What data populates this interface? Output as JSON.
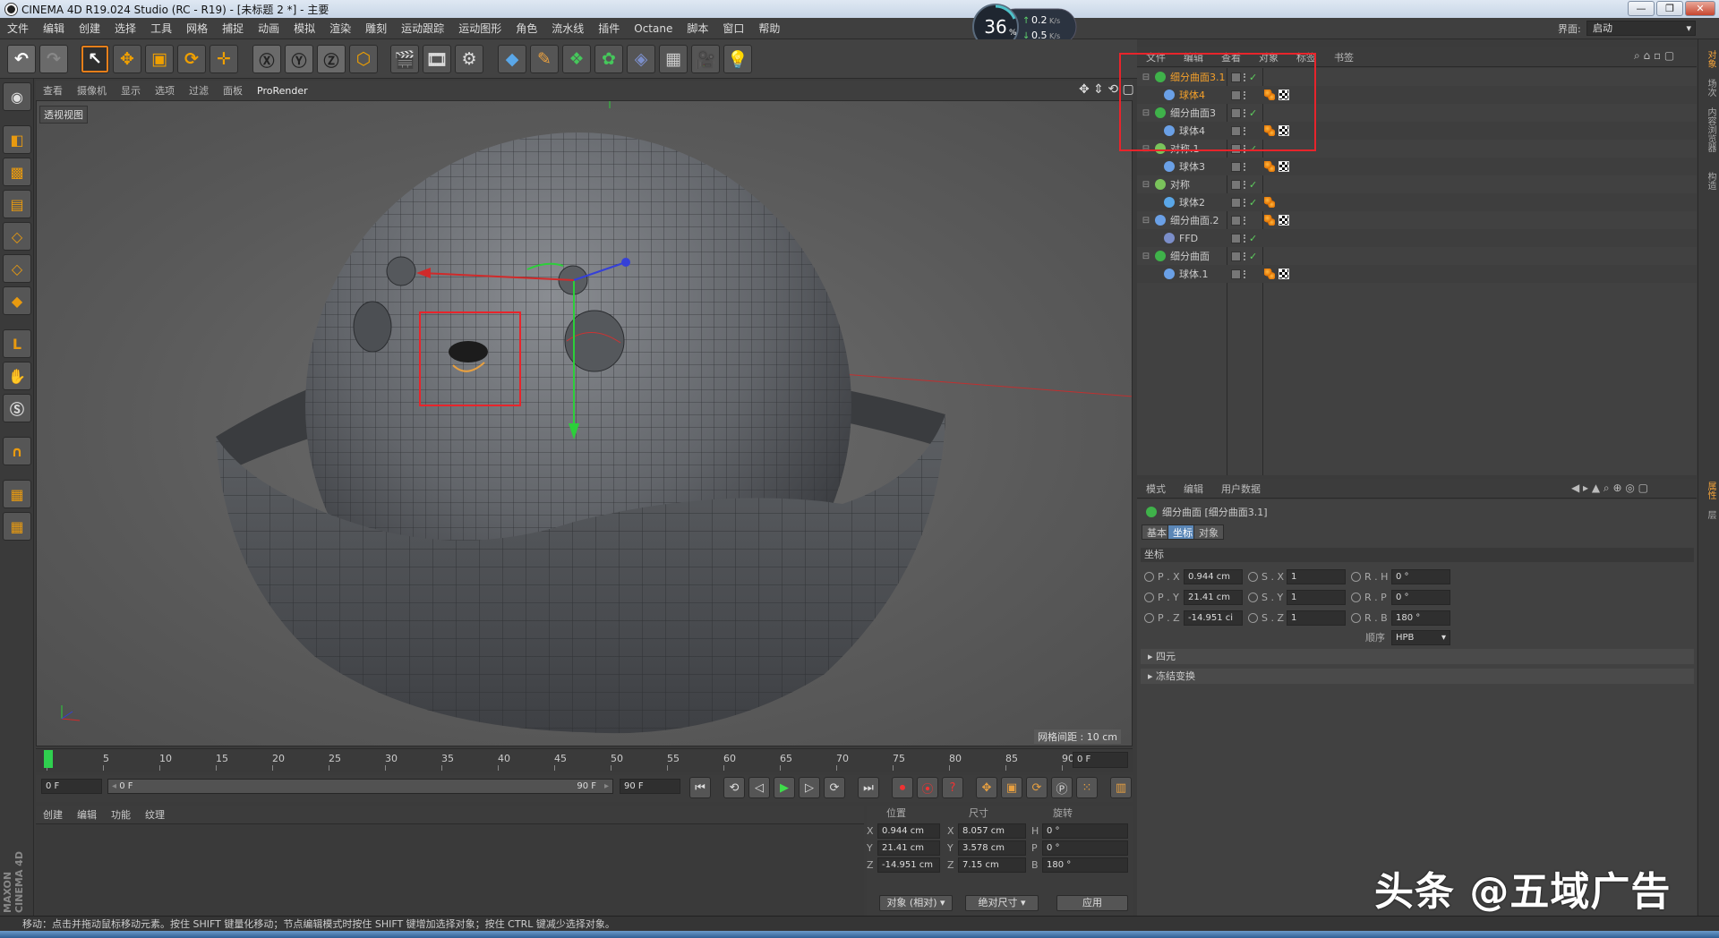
{
  "window": {
    "title": "CINEMA 4D R19.024 Studio (RC - R19) - [未标题 2 *] - 主要",
    "min": "—",
    "max": "❐",
    "close": "✕"
  },
  "menu": [
    "文件",
    "编辑",
    "创建",
    "选择",
    "工具",
    "网格",
    "捕捉",
    "动画",
    "模拟",
    "渲染",
    "雕刻",
    "运动跟踪",
    "运动图形",
    "角色",
    "流水线",
    "插件",
    "Octane",
    "脚本",
    "窗口",
    "帮助"
  ],
  "layout": {
    "label": "界面:",
    "value": "启动"
  },
  "network": {
    "percent": "36",
    "percent_unit": "%",
    "up": "0.2",
    "down": "0.5",
    "unit": "K/s"
  },
  "viewport": {
    "menu": [
      "查看",
      "摄像机",
      "显示",
      "选项",
      "过滤",
      "面板",
      "ProRender"
    ],
    "view_name": "透视视图",
    "grid_spacing": "网格间距 : 10 cm"
  },
  "object_manager": {
    "menu": [
      "文件",
      "编辑",
      "查看",
      "对象",
      "标签",
      "书签"
    ],
    "rows": [
      {
        "name": "细分曲面3.1",
        "selected": true,
        "indent": 0,
        "icon": "#3fb24a",
        "toggle": "⊟",
        "check": "✓",
        "tags": []
      },
      {
        "name": "球体4",
        "selected": true,
        "indent": 1,
        "icon": "#6aa0e6",
        "toggle": "",
        "check": "",
        "tags": [
          "phong",
          "checker"
        ]
      },
      {
        "name": "细分曲面3",
        "selected": false,
        "indent": 0,
        "icon": "#3fb24a",
        "toggle": "⊟",
        "check": "✓",
        "tags": []
      },
      {
        "name": "球体4",
        "selected": false,
        "indent": 1,
        "icon": "#6aa0e6",
        "toggle": "",
        "check": "",
        "tags": [
          "phong",
          "checker"
        ]
      },
      {
        "name": "对称.1",
        "selected": false,
        "indent": 0,
        "icon": "#7ac35b",
        "toggle": "⊟",
        "check": "✓",
        "tags": []
      },
      {
        "name": "球体3",
        "selected": false,
        "indent": 1,
        "icon": "#6aa0e6",
        "toggle": "",
        "check": "",
        "tags": [
          "phong",
          "checker"
        ]
      },
      {
        "name": "对称",
        "selected": false,
        "indent": 0,
        "icon": "#7ac35b",
        "toggle": "⊟",
        "check": "✓",
        "tags": []
      },
      {
        "name": "球体2",
        "selected": false,
        "indent": 1,
        "icon": "#5aa7e8",
        "toggle": "",
        "check": "✓",
        "tags": [
          "phong"
        ]
      },
      {
        "name": "细分曲面.2",
        "selected": false,
        "indent": 0,
        "icon": "#6aa0e6",
        "toggle": "⊟",
        "check": "",
        "tags": [
          "phong",
          "checker"
        ]
      },
      {
        "name": "FFD",
        "selected": false,
        "indent": 1,
        "icon": "#7b8ec9",
        "toggle": "",
        "check": "✓",
        "tags": []
      },
      {
        "name": "细分曲面",
        "selected": false,
        "indent": 0,
        "icon": "#3fb24a",
        "toggle": "⊟",
        "check": "✓",
        "tags": []
      },
      {
        "name": "球体.1",
        "selected": false,
        "indent": 1,
        "icon": "#6aa0e6",
        "toggle": "",
        "check": "",
        "tags": [
          "phong",
          "checker"
        ]
      }
    ]
  },
  "attributes": {
    "menu": [
      "模式",
      "编辑",
      "用户数据"
    ],
    "title": "细分曲面 [细分曲面3.1]",
    "tabs": [
      "基本",
      "坐标",
      "对象"
    ],
    "active_tab": "坐标",
    "section": "坐标",
    "pos": {
      "label_x": "P . X",
      "label_y": "P . Y",
      "label_z": "P . Z",
      "x": "0.944 cm",
      "y": "21.41 cm",
      "z": "-14.951 ci"
    },
    "scale": {
      "label_x": "S . X",
      "label_y": "S . Y",
      "label_z": "S . Z",
      "x": "1",
      "y": "1",
      "z": "1"
    },
    "rot": {
      "label_h": "R . H",
      "label_p": "R . P",
      "label_b": "R . B",
      "h": "0 °",
      "p": "0 °",
      "b": "180 °"
    },
    "order_label": "顺序",
    "order_value": "HPB",
    "expanders": [
      "四元",
      "冻结变换"
    ]
  },
  "timeline": {
    "ticks": [
      "0",
      "5",
      "10",
      "15",
      "20",
      "25",
      "30",
      "35",
      "40",
      "45",
      "50",
      "55",
      "60",
      "65",
      "70",
      "75",
      "80",
      "85",
      "90"
    ],
    "current": "0 F",
    "start": "0 F",
    "range_start": "0 F",
    "range_end": "90 F",
    "end": "90 F"
  },
  "material": {
    "menu": [
      "创建",
      "编辑",
      "功能",
      "纹理"
    ]
  },
  "coords": {
    "headers": [
      "位置",
      "尺寸",
      "旋转"
    ],
    "rows": [
      {
        "axis": "X",
        "pos": "0.944 cm",
        "saxis": "X",
        "size": "8.057 cm",
        "raxis": "H",
        "rot": "0 °"
      },
      {
        "axis": "Y",
        "pos": "21.41 cm",
        "saxis": "Y",
        "size": "3.578 cm",
        "raxis": "P",
        "rot": "0 °"
      },
      {
        "axis": "Z",
        "pos": "-14.951 cm",
        "saxis": "Z",
        "size": "7.15 cm",
        "raxis": "B",
        "rot": "180 °"
      }
    ],
    "mode1": "对象 (相对)",
    "mode2": "绝对尺寸",
    "apply": "应用"
  },
  "status": "移动：点击并拖动鼠标移动元素。按住 SHIFT 键量化移动；节点编辑模式时按住 SHIFT 键增加选择对象；按住 CTRL 键减少选择对象。",
  "brand": "MAXON CINEMA 4D",
  "watermark": "头条 @五域广告",
  "right_tabs": [
    "对象",
    "场次",
    "内容浏览器",
    "构造",
    "属性",
    "层"
  ],
  "colors": {
    "accent": "#f4a02a",
    "highlight": "#e8242b",
    "active_tab": "#5b87b7"
  }
}
